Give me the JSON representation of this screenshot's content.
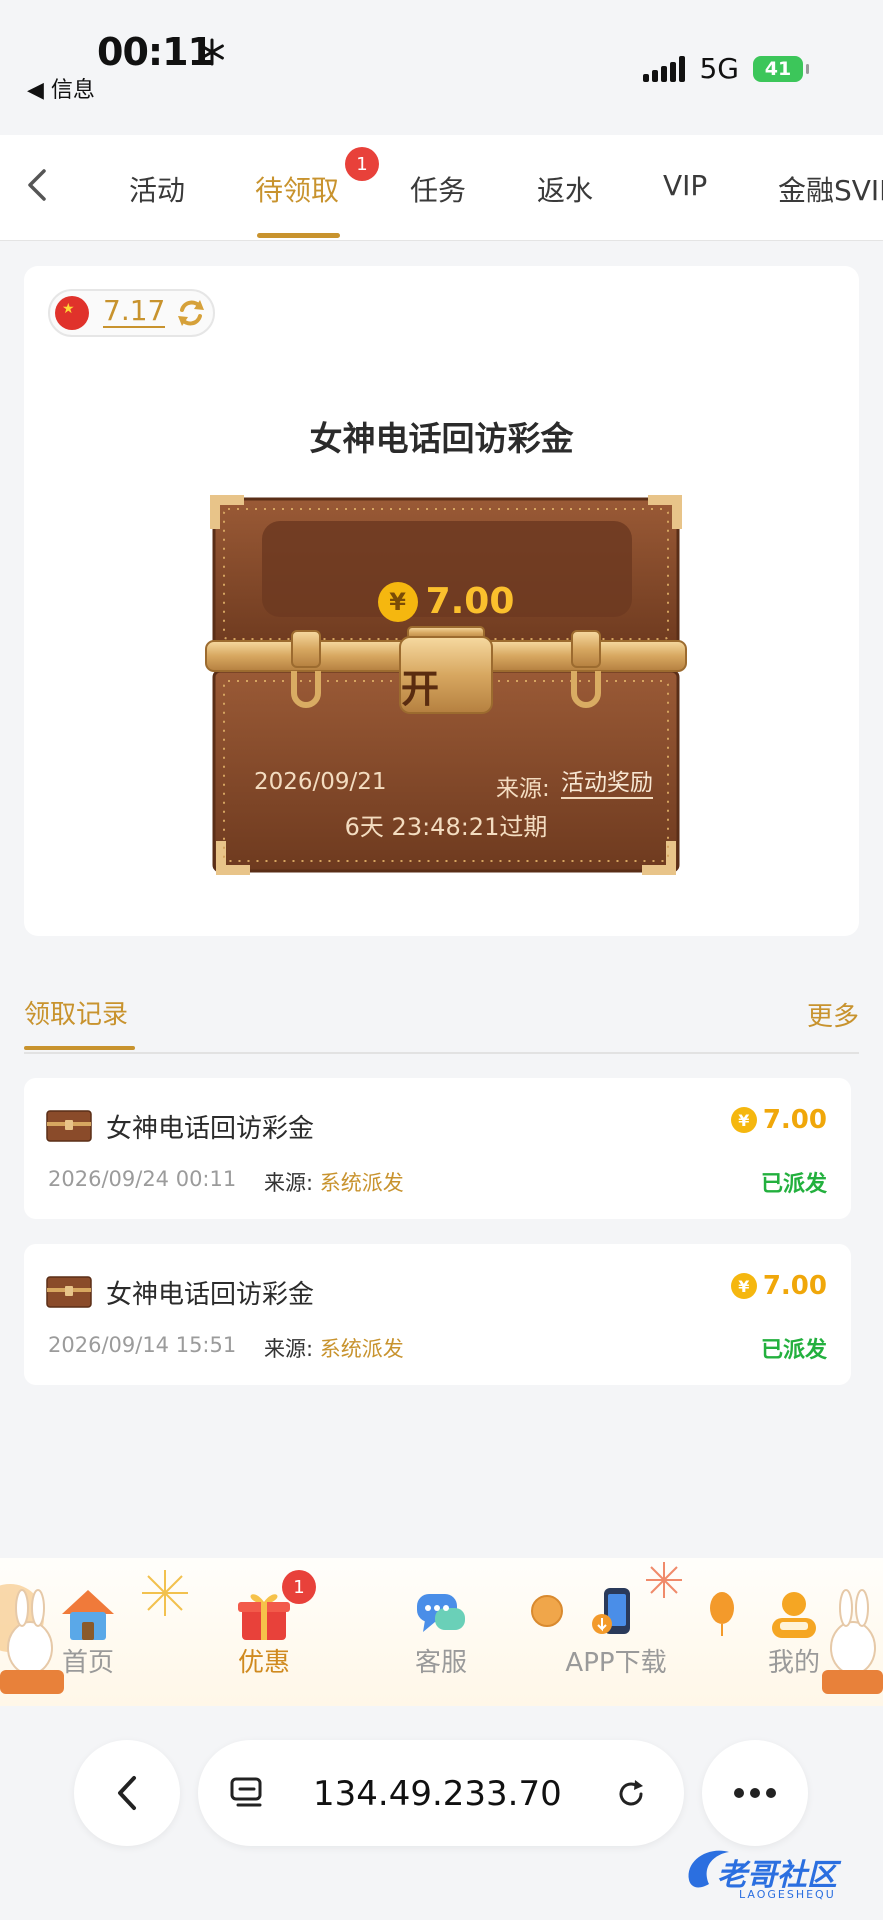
{
  "status_bar": {
    "time": "00:11",
    "back_app": "◀ 信息",
    "network": "5G",
    "battery": "41"
  },
  "tabs": {
    "items": [
      {
        "label": "活动"
      },
      {
        "label": "待领取",
        "badge": "1"
      },
      {
        "label": "任务"
      },
      {
        "label": "返水"
      },
      {
        "label": "VIP"
      },
      {
        "label": "金融SVIP"
      }
    ],
    "active_index": 1
  },
  "balance": {
    "value": "7.17"
  },
  "reward_card": {
    "title": "女神电话回访彩金",
    "amount": "7.00",
    "currency_symbol": "¥",
    "lock_label": "开",
    "date": "2026/09/21",
    "source_label": "来源:",
    "source_value": "活动奖励",
    "expire": "6天 23:48:21过期"
  },
  "records": {
    "title": "领取记录",
    "more": "更多",
    "items": [
      {
        "name": "女神电话回访彩金",
        "amount": "7.00",
        "datetime": "2026/09/24 00:11",
        "source_label": "来源:",
        "source_value": "系统派发",
        "status": "已派发"
      },
      {
        "name": "女神电话回访彩金",
        "amount": "7.00",
        "datetime": "2026/09/14 15:51",
        "source_label": "来源:",
        "source_value": "系统派发",
        "status": "已派发"
      }
    ]
  },
  "bottom_nav": {
    "items": [
      {
        "label": "首页",
        "icon": "house-icon"
      },
      {
        "label": "优惠",
        "icon": "gift-icon",
        "badge": "1"
      },
      {
        "label": "客服",
        "icon": "chat-icon"
      },
      {
        "label": "APP下载",
        "icon": "phone-download-icon"
      },
      {
        "label": "我的",
        "icon": "profile-icon"
      }
    ],
    "active_index": 1
  },
  "browser": {
    "url": "134.49.233.70"
  },
  "watermark": {
    "text": "老哥社区",
    "sub": "LAOGESHEQU"
  },
  "colors": {
    "accent": "#c8932e",
    "badge": "#e8413a",
    "success": "#23b03e",
    "amount": "#f0a70a"
  }
}
